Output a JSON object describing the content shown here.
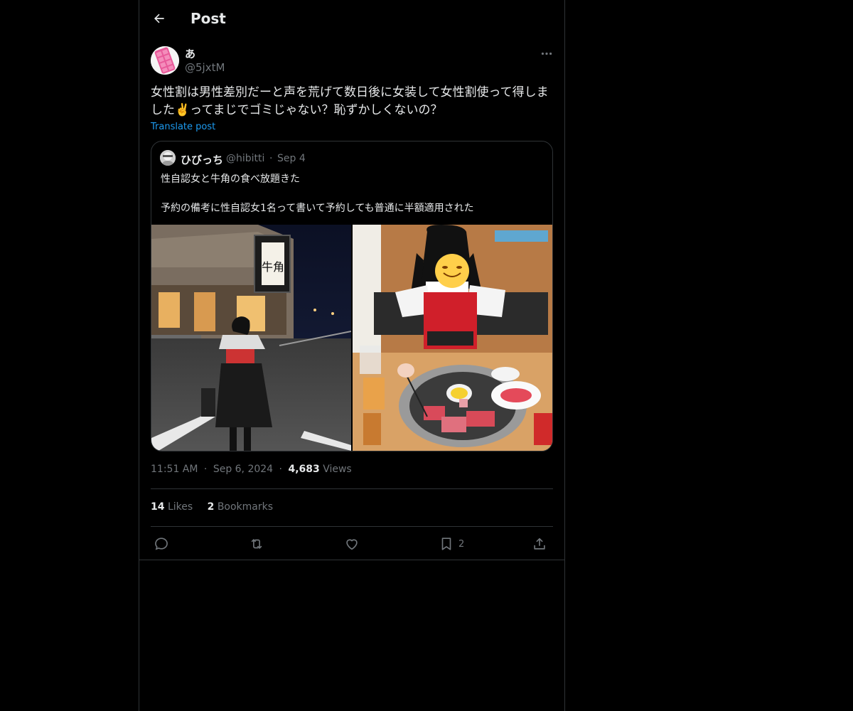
{
  "header": {
    "title": "Post"
  },
  "author": {
    "display_name": "あ",
    "handle": "@5jxtM"
  },
  "post": {
    "text": "女性割は男性差別だーと声を荒げて数日後に女装して女性割使って得しました✌️ってまじでゴミじゃない？恥ずかしくないの？",
    "translate_label": "Translate post"
  },
  "quote": {
    "display_name": "ひびっち",
    "handle": "@hibitti",
    "separator": "·",
    "date": "Sep 4",
    "line1": "性自認女と牛角の食べ放題きた",
    "line2": "予約の備考に性自認女1名って書いて予約しても普通に半額適用された",
    "sign_text": "牛角"
  },
  "meta": {
    "time": "11:51 AM",
    "separator": "·",
    "date": "Sep 6, 2024",
    "views_count": "4,683",
    "views_label": "Views"
  },
  "stats": {
    "likes_count": "14",
    "likes_label": "Likes",
    "bookmarks_count": "2",
    "bookmarks_label": "Bookmarks"
  },
  "actions": {
    "bookmark_count": "2",
    "icons": [
      "reply-icon",
      "repost-icon",
      "like-icon",
      "bookmark-icon",
      "share-icon"
    ]
  },
  "colors": {
    "background": "#000000",
    "text_primary": "#e7e9ea",
    "text_secondary": "#71767b",
    "link": "#1d9bf0",
    "border": "#2f3336"
  }
}
